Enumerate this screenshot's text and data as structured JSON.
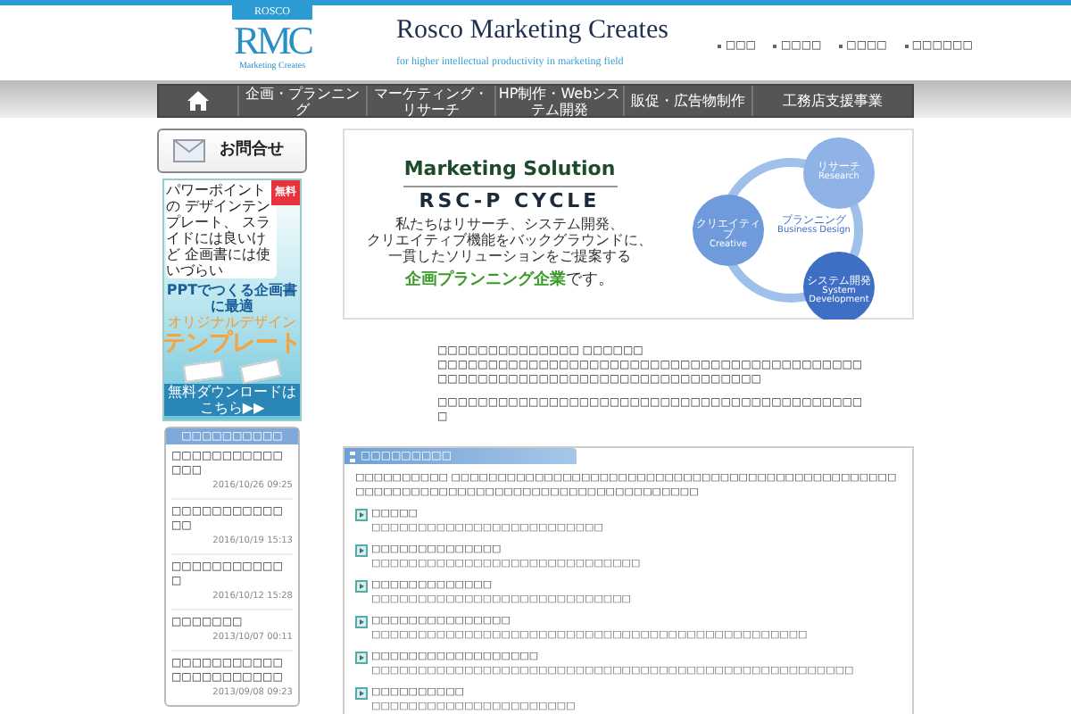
{
  "header": {
    "logo": {
      "top": "ROSCO",
      "mark": "RMC",
      "bottom": "Marketing Creates"
    },
    "title": "Rosco Marketing Creates",
    "tagline": "for higher intellectual productivity in marketing field",
    "links": [
      "□□□",
      "□□□□",
      "□□□□",
      "□□□□□□"
    ]
  },
  "nav": [
    "企画・プランニング",
    "マーケティング・リサーチ",
    "HP制作・Webシステム開発",
    "販促・広告物制作",
    "工務店支援事業"
  ],
  "sidebar": {
    "contact_button": "お問合せ",
    "ad": {
      "bubble": "パワーポイントの デザインテンプレート、 スライドには良いけど 企画書には使いづらい",
      "ribbon": "無料",
      "lead": "PPTでつくる企画書に最適",
      "sub": "オリジナルデザイン",
      "headline": "テンプレート",
      "cta": "無料ダウンロードはこちら▶▶"
    },
    "news": {
      "title": "□□□□□□□□□□",
      "items": [
        {
          "title": "□□□□□□□□□□□□□□",
          "date": "2016/10/26 09:25"
        },
        {
          "title": "□□□□□□□□□□□□□",
          "date": "2016/10/19 15:13"
        },
        {
          "title": "□□□□□□□□□□□□",
          "date": "2016/10/12 15:28"
        },
        {
          "title": "□□□□□□□",
          "date": "2013/10/07 00:11"
        },
        {
          "title": "□□□□□□□□□□□□□□□□□□□□□□",
          "date": "2013/09/08 09:23"
        }
      ]
    }
  },
  "banner": {
    "heading": "Marketing Solution",
    "subheading": "RSC-P CYCLE",
    "lines": [
      "私たちはリサーチ、システム開発、",
      "クリエイティブ機能をバックグラウンドに、",
      "一貫したソリューションをご提案する"
    ],
    "tagline_highlight": "企画プランニング企業",
    "tagline_rest": "です。",
    "cycle": [
      {
        "label": "リサーチ",
        "sub": "Research"
      },
      {
        "label": "システム開発",
        "sub": "System Development"
      },
      {
        "label": "クリエイティブ",
        "sub": "Creative"
      }
    ],
    "center": {
      "label": "プランニング",
      "sub": "Business Design"
    }
  },
  "intro": {
    "line1": "□□□□□□□□□□□□□□ □□□□□□",
    "line2": "□□□□□□□□□□□□□□□□□□□□□□□□□□□□□□□□□□□□□□□□□□□□□□□□□□□□□□□□□□□□□□□□□□□□□□□□□□",
    "para2": "□□□□□□□□□□□□□□□□□□□□□□□□□□□□□□□□□□□□□□□□□□□"
  },
  "section": {
    "title": "□□□□□□□□□",
    "intro": "□□□□□□□□□□ □□□□□□□□□□□□□□□□□□□□□□□□□□□□□□□□□□□□□□□□□□□□□□□□□□□□□□□□□□□□□□□□□□□□□□□□□□□□□□□□□□□□□",
    "items": [
      {
        "title": "□□□□□",
        "desc": "□□□□□□□□□□□□□□□□□□□□□□□□□"
      },
      {
        "title": "□□□□□□□□□□□□□□",
        "desc": "□□□□□□□□□□□□□□□□□□□□□□□□□□□□□"
      },
      {
        "title": "□□□□□□□□□□□□□",
        "desc": "□□□□□□□□□□□□□□□□□□□□□□□□□□□□"
      },
      {
        "title": "□□□□□□□□□□□□□□□",
        "desc": "□□□□□□□□□□□□□□□□□□□□□□□□□□□□□□□□□□□□□□□□□□□□□□□"
      },
      {
        "title": "□□□□□□□□□□□□□□□□□□",
        "desc": "□□□□□□□□□□□□□□□□□□□□□□□□□□□□□□□□□□□□□□□□□□□□□□□□□□□□"
      },
      {
        "title": "□□□□□□□□□□",
        "desc": "□□□□□□□□□□□□□□□□□□□□□□"
      }
    ]
  }
}
